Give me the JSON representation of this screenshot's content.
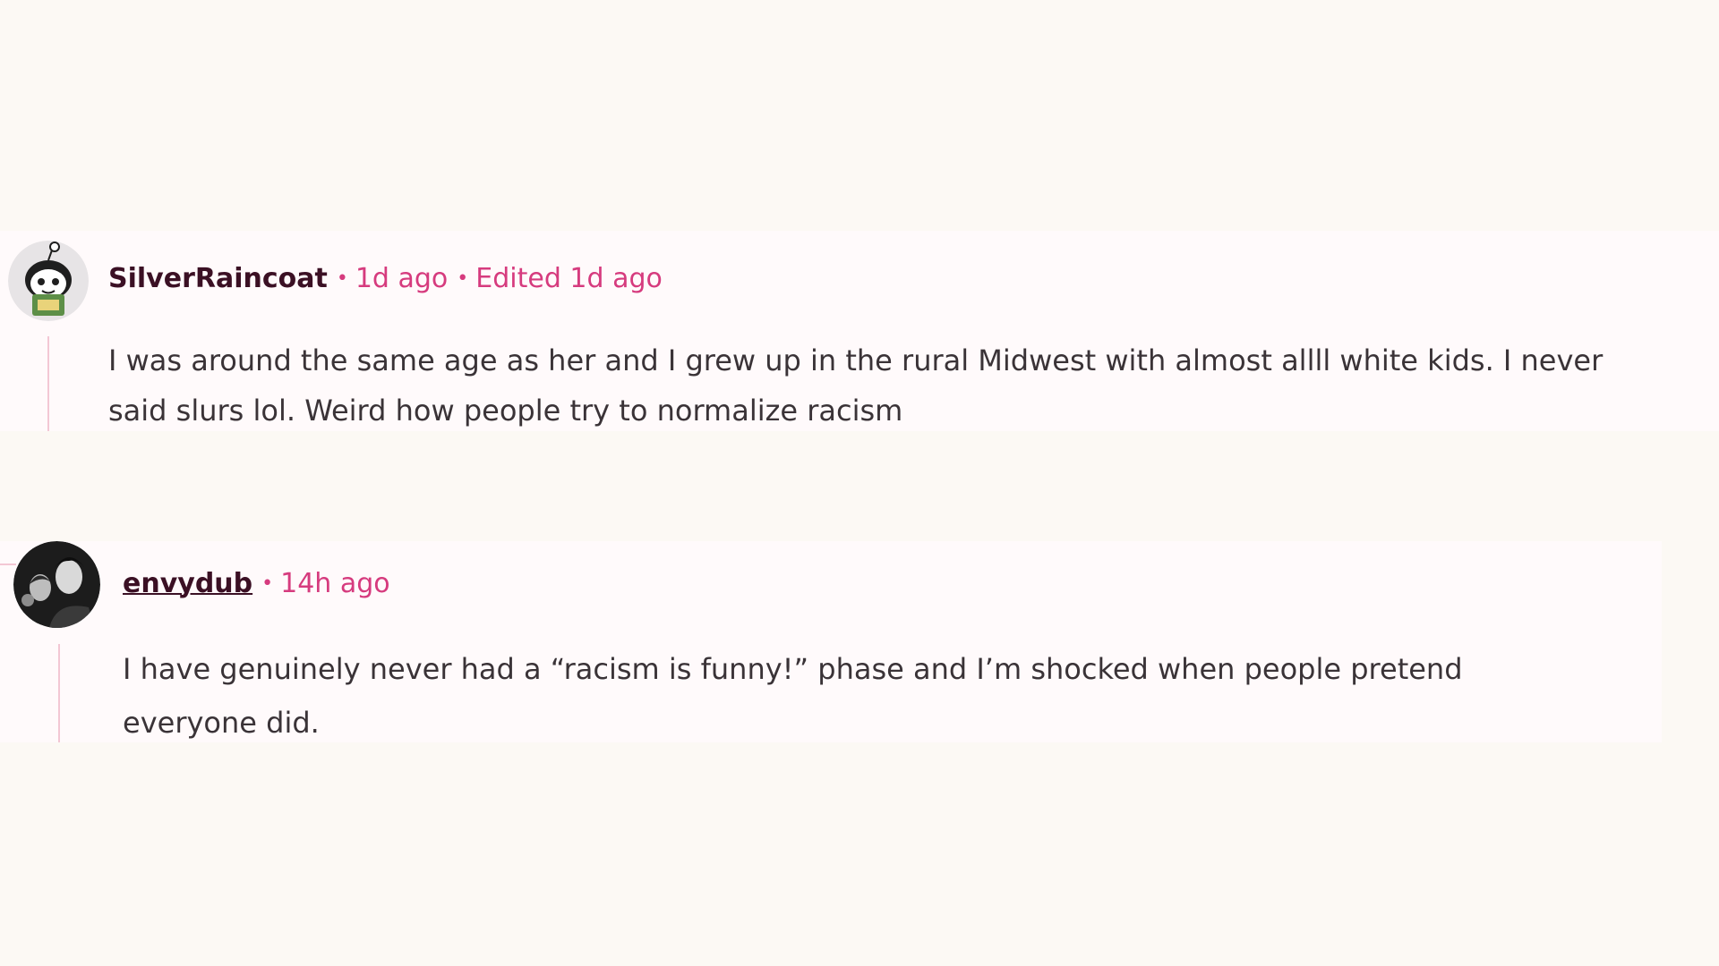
{
  "comments": [
    {
      "username": "SilverRaincoat",
      "time": "1d ago",
      "edited": "Edited 1d ago",
      "body_line1": "I was around the same age as her and I grew up in the rural Midwest with almost allll white kids. I never",
      "body_line2": "said slurs lol. Weird how people try to normalize racism",
      "avatar_icon": "snoo-avatar-icon"
    },
    {
      "username": "envydub",
      "time": "14h ago",
      "body_line1": "I have genuinely never had a “racism is funny!” phase and I’m shocked when people pretend",
      "body_line2": "everyone did.",
      "avatar_icon": "photo-avatar-icon"
    }
  ],
  "colors": {
    "background": "#fcf9f4",
    "comment_background": "#fffafb",
    "username": "#3b1024",
    "meta_accent": "#d63b7e",
    "thread_line": "#f3c7d4",
    "body_text": "#3a3337"
  }
}
